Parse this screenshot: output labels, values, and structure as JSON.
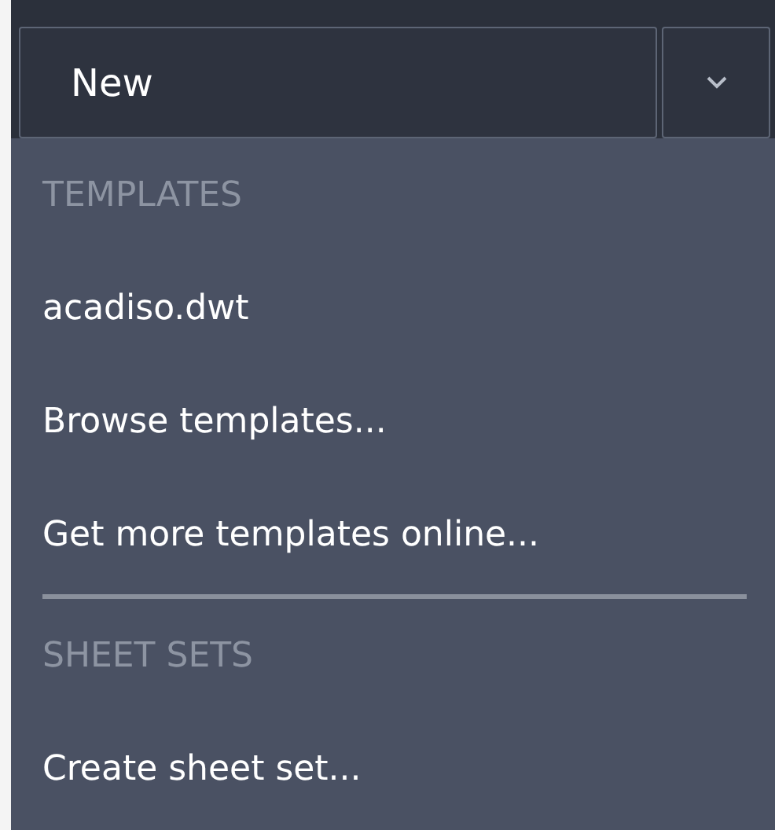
{
  "split_button": {
    "label": "New"
  },
  "menu": {
    "sections": [
      {
        "header": "TEMPLATES",
        "items": [
          "acadiso.dwt",
          "Browse templates...",
          "Get more templates online..."
        ]
      },
      {
        "header": "SHEET SETS",
        "items": [
          "Create sheet set..."
        ]
      }
    ]
  }
}
